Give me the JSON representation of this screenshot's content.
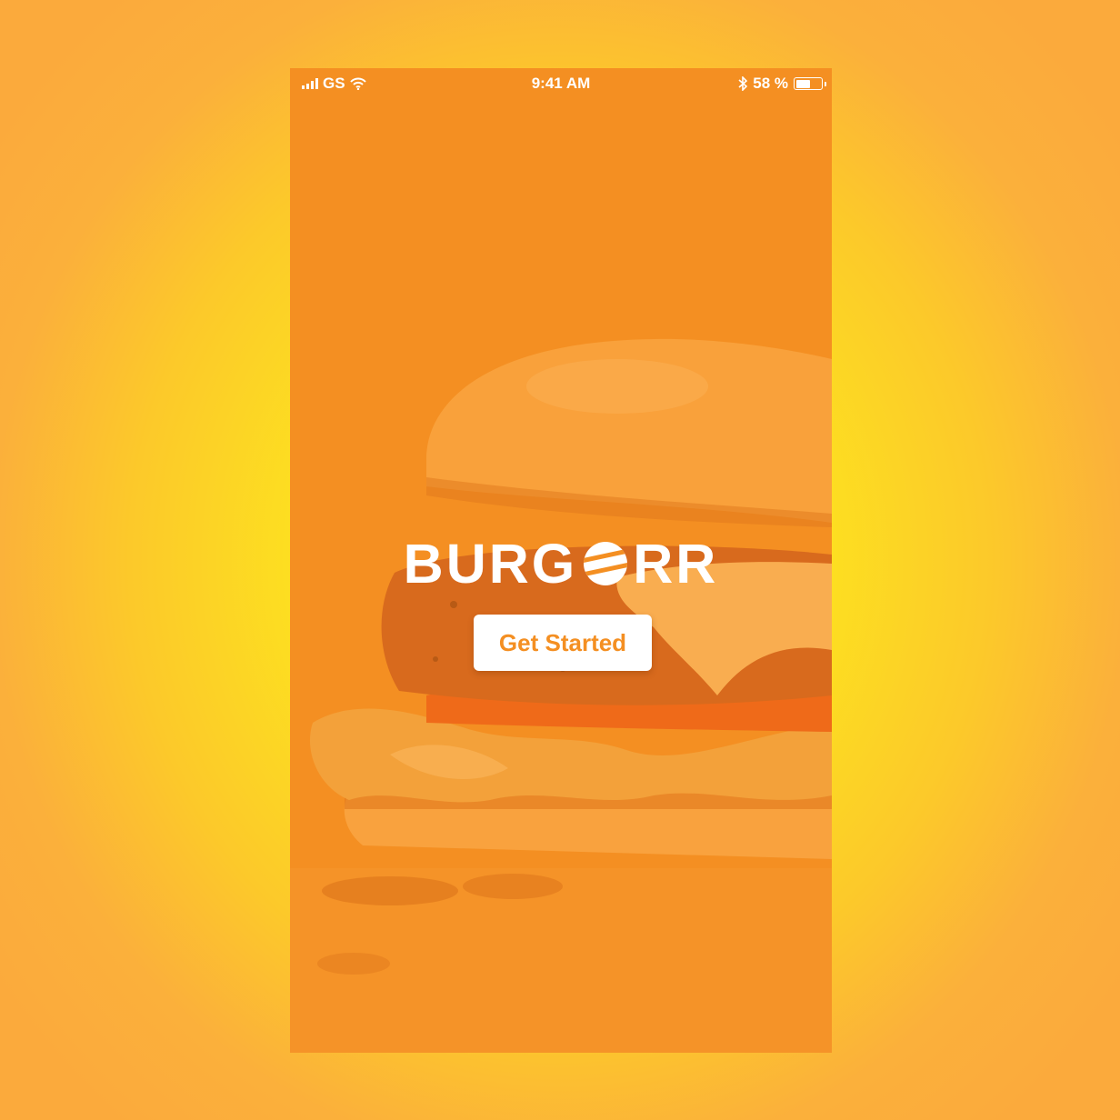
{
  "status_bar": {
    "carrier": "GS",
    "time": "9:41 AM",
    "battery": "58 %",
    "battery_level": 0.58
  },
  "logo": {
    "left_text": "BURG",
    "right_text": "RR"
  },
  "get_started_label": "Get Started",
  "colors": {
    "background_center": "#fdee1c",
    "background_edge": "#fbaa3c",
    "overlay": "#f48f22",
    "text": "#ffffff"
  },
  "icons": [
    "signal-icon",
    "wifi-icon",
    "bluetooth-icon",
    "battery-icon",
    "burger-logo-icon"
  ]
}
